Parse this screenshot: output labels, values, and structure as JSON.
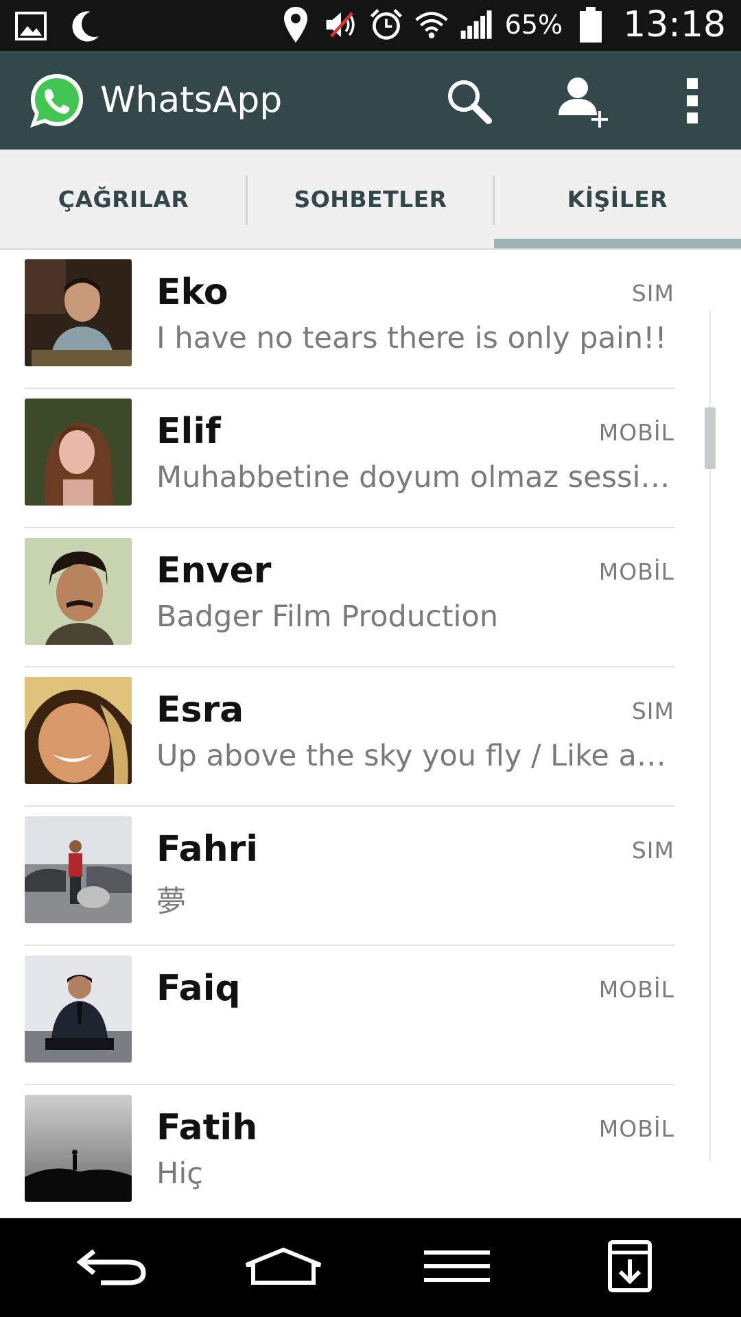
{
  "status_bar": {
    "icons_left": [
      "image-icon",
      "moon-icon"
    ],
    "icons_right": [
      "location-icon",
      "muted-icon",
      "alarm-icon",
      "wifi-icon",
      "signal-icon"
    ],
    "battery_percent": "65%",
    "time": "13:18"
  },
  "app_bar": {
    "title": "WhatsApp",
    "actions": [
      "search-icon",
      "add-contact-icon",
      "overflow-menu-icon"
    ],
    "brand_color": "#33484a"
  },
  "tabs": [
    {
      "label": "ÇAĞRILAR",
      "selected": false
    },
    {
      "label": "SOHBETLER",
      "selected": false
    },
    {
      "label": "KİŞİLER",
      "selected": true
    }
  ],
  "contacts": [
    {
      "name": "Eko",
      "status": "I have no tears there is only pain!!",
      "type": "SIM"
    },
    {
      "name": "Elif",
      "status": "Muhabbetine doyum olmaz sessizliğine doyum olmaz",
      "type": "MOBİL"
    },
    {
      "name": "Enver",
      "status": "Badger Film Production",
      "type": "MOBİL"
    },
    {
      "name": "Esra",
      "status": "Up above the sky you fly / Like a tea tray in the sky",
      "type": "SIM"
    },
    {
      "name": "Fahri",
      "status": "夢",
      "type": "SIM"
    },
    {
      "name": "Faiq",
      "status": "",
      "type": "MOBİL"
    },
    {
      "name": "Fatih",
      "status": "Hiç",
      "type": "MOBİL"
    }
  ],
  "nav_bar": [
    "back-icon",
    "home-icon",
    "menu-icon",
    "download-icon"
  ]
}
